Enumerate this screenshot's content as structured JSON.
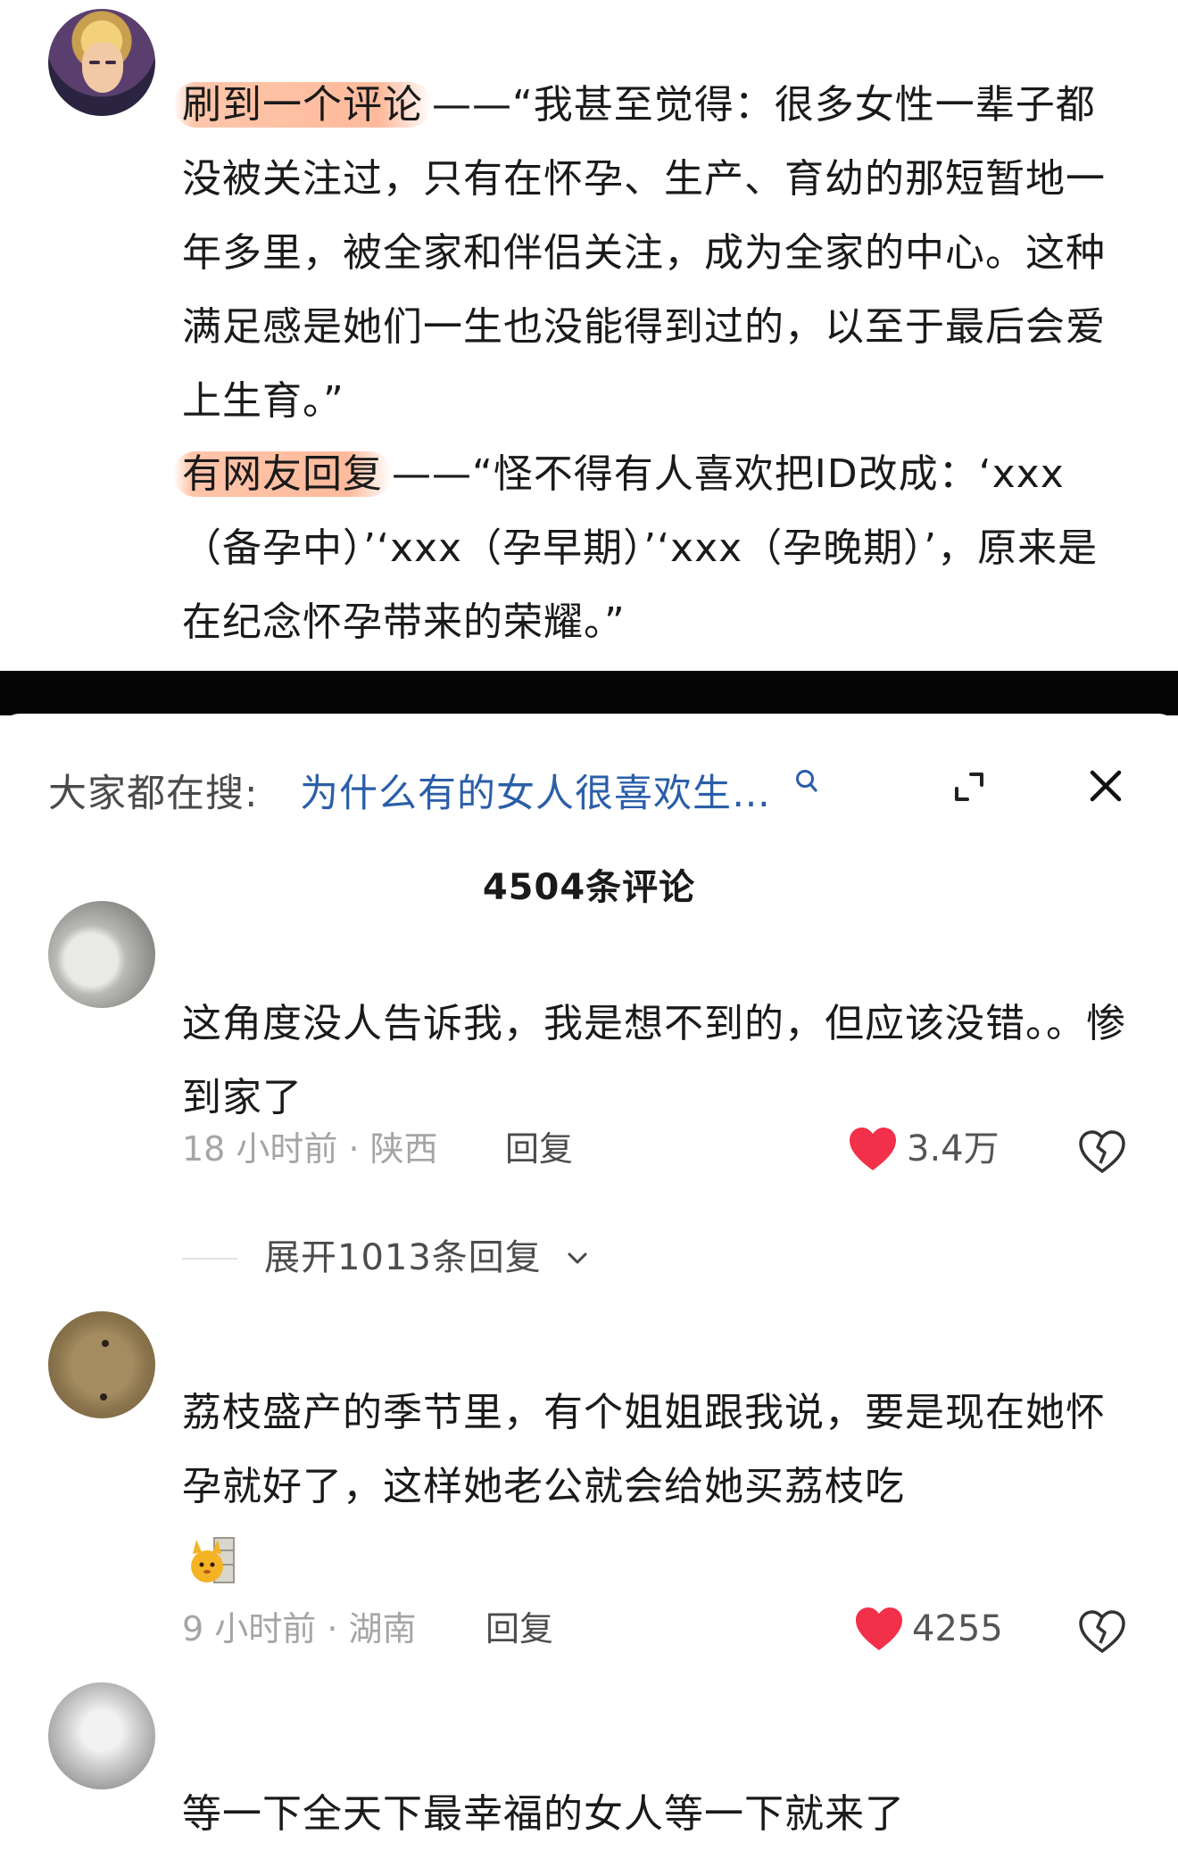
{
  "post": {
    "para1_highlight": "刷到一个评论",
    "para1_rest": "——“我甚至觉得：很多女性一辈子都没被关注过，只有在怀孕、生产、育幼的那短暂地一年多里，被全家和伴侣关注，成为全家的中心。这种满足感是她们一生也没能得到过的，以至于最后会爱上生育。”",
    "para2_highlight": "有网友回复",
    "para2_rest": "——“怪不得有人喜欢把ID改成：‘xxx（备孕中）’‘xxx（孕早期）’‘xxx（孕晚期）’，原来是在纪念怀孕带来的荣耀。”"
  },
  "search": {
    "prefix": "大家都在搜:",
    "query": "为什么有的女人很喜欢生…"
  },
  "comments_header": {
    "count_label": "4504条评论"
  },
  "comments": [
    {
      "text": "这角度没人告诉我，我是想不到的，但应该没错。。惨到家了",
      "meta": "18 小时前 · 陕西",
      "reply_label": "回复",
      "likes": "3.4万",
      "expand_label": "展开1013条回复"
    },
    {
      "text": "荔枝盛产的季节里，有个姐姐跟我说，要是现在她怀孕就好了，这样她老公就会给她买荔枝吃",
      "meta": "9 小时前 · 湖南",
      "reply_label": "回复",
      "likes": "4255"
    },
    {
      "text": "等一下全天下最幸福的女人等一下就来了"
    }
  ],
  "colors": {
    "highlight": "#ff9a6a",
    "search_query": "#2a5ea8",
    "heart": "#f2304a",
    "divider_band": "#050505"
  },
  "icons": [
    "search-icon",
    "expand-icon",
    "close-icon",
    "heart-icon",
    "broken-heart-icon",
    "chevron-down-icon"
  ]
}
